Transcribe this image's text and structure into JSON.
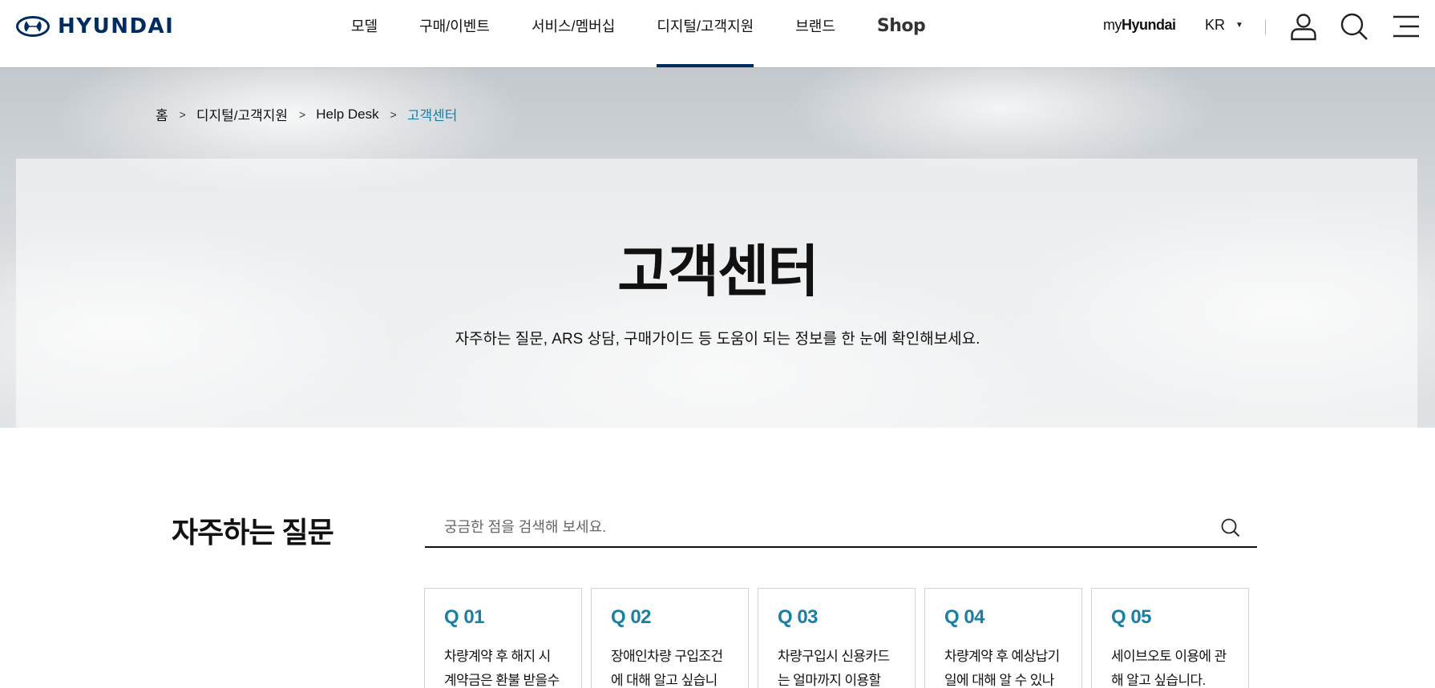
{
  "header": {
    "logo_text": "HYUNDAI",
    "nav": [
      {
        "label": "모델"
      },
      {
        "label": "구매/이벤트"
      },
      {
        "label": "서비스/멤버십"
      },
      {
        "label": "디지털/고객지원",
        "active": true
      },
      {
        "label": "브랜드"
      }
    ],
    "shop_label": "Shop",
    "myhyundai_prefix": "my",
    "myhyundai_brand": "Hyundai",
    "language": "KR",
    "icons": [
      "user-icon",
      "search-icon",
      "menu-icon"
    ]
  },
  "breadcrumb": [
    "홈",
    "디지털/고객지원",
    "Help Desk",
    "고객센터"
  ],
  "hero": {
    "title": "고객센터",
    "description": "자주하는 질문, ARS 상담, 구매가이드 등 도움이 되는 정보를 한 눈에 확인해보세요."
  },
  "faq": {
    "title": "자주하는 질문",
    "search_placeholder": "궁금한 점을 검색해 보세요.",
    "search_value": "",
    "cards": [
      {
        "num": "Q 01",
        "text": "차량계약 후 해지 시 계약금은 환불 받을수 있"
      },
      {
        "num": "Q 02",
        "text": "장애인차량 구입조건에 대해 알고 싶습니다."
      },
      {
        "num": "Q 03",
        "text": "차량구입시 신용카드는 얼마까지 이용할 수"
      },
      {
        "num": "Q 04",
        "text": "차량계약 후 예상납기일에 대해 알 수 있나"
      },
      {
        "num": "Q 05",
        "text": "세이브오토 이용에 관해 알고 싶습니다."
      }
    ]
  },
  "colors": {
    "brand_navy": "#002c5f",
    "accent_teal": "#1a7ea6"
  }
}
